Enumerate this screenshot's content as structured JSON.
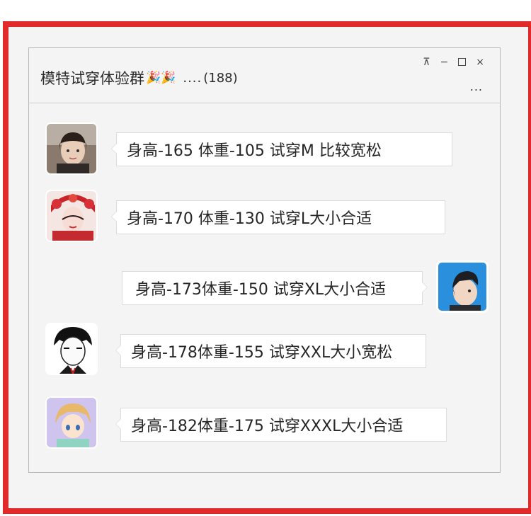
{
  "window": {
    "group_name": "模特试穿体验群",
    "title_emoji": "🎉🎉",
    "title_ellipsis": "....",
    "member_count": "(188)",
    "controls": {
      "pin_label": "⊼",
      "minimize_label": "−",
      "close_label": "×",
      "more_label": "..."
    }
  },
  "messages": [
    {
      "text": "身高-165 体重-105   试穿M 比较宽松",
      "avatar": "girl-photo-avatar",
      "side": "left"
    },
    {
      "text": "身高-170 体重-130    试穿L大小合适",
      "avatar": "opera-girl-avatar",
      "side": "left"
    },
    {
      "text": "身高-173体重-150     试穿XL大小合适",
      "avatar": "cartoon-boy-avatar",
      "side": "right"
    },
    {
      "text": "身高-178体重-155     试穿XXL大小宽松",
      "avatar": "manga-boy-avatar",
      "side": "left"
    },
    {
      "text": "身高-182体重-175     试穿XXXL大小合适",
      "avatar": "anime-kid-avatar",
      "side": "left"
    }
  ],
  "colors": {
    "frame_border": "#e12a2a",
    "window_bg": "#f4f4f4",
    "bubble_bg": "#ffffff"
  }
}
